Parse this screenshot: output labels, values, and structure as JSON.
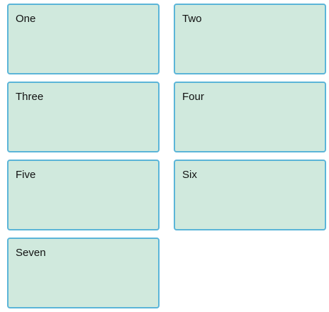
{
  "cards": [
    {
      "label": "One"
    },
    {
      "label": "Two"
    },
    {
      "label": "Three"
    },
    {
      "label": "Four"
    },
    {
      "label": "Five"
    },
    {
      "label": "Six"
    },
    {
      "label": "Seven"
    }
  ],
  "colors": {
    "card_background": "#d0e9dd",
    "card_border": "#5bb5d8",
    "text": "#111111"
  }
}
